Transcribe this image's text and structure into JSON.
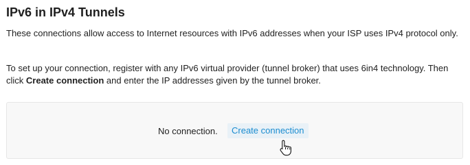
{
  "page": {
    "title": "IPv6 in IPv4 Tunnels"
  },
  "description": {
    "paragraph1": "These connections allow access to Internet resources with IPv6 addresses when your ISP uses IPv4 protocol only.",
    "paragraph2_prefix": "To set up your connection, register with any IPv6 virtual provider (tunnel broker) that uses 6in4 technology. Then click ",
    "paragraph2_bold": "Create connection",
    "paragraph2_suffix": " and enter the IP addresses given by the tunnel broker."
  },
  "panel": {
    "status_text": "No connection.",
    "create_label": "Create connection"
  },
  "icons": {
    "cursor": "hand-pointer-icon"
  },
  "colors": {
    "link": "#1a8cd0",
    "link_bg": "#e9f1f7",
    "panel_bg": "#f8f8f8"
  }
}
